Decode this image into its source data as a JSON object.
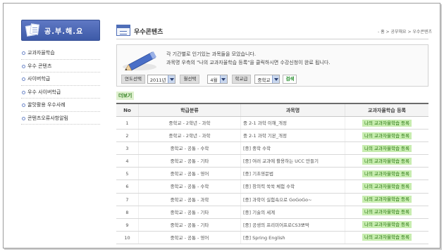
{
  "sidebar": {
    "title": "공.부.해.요",
    "items": [
      {
        "label": "교과자율학습"
      },
      {
        "label": "우수 콘텐츠"
      },
      {
        "label": "사이버학급"
      },
      {
        "label": "우수 사이버학급"
      },
      {
        "label": "꿀맛활용 우수사례"
      },
      {
        "label": "콘텐츠오류사항알림"
      }
    ]
  },
  "header": {
    "title": "우수콘텐츠",
    "breadcrumb": "- 홈 > 공부해요 > 우수콘텐츠"
  },
  "info": {
    "line1": "각 기간별로 인기있는 과목들을 모았습니다.",
    "line2": "과목명 우측의 \"나의 교과자율학습 등록\"을 클릭하시면 수강신청이 완료 됩니다."
  },
  "filters": {
    "year_label": "연도선택",
    "year_value": "2011년",
    "month_label": "월선택",
    "month_value": "4월",
    "school_label": "학교급",
    "school_value": "중학교",
    "search_label": "검색"
  },
  "more_label": "더보기",
  "table": {
    "headers": {
      "no": "No",
      "category": "학급분류",
      "title": "과목명",
      "register": "교과자율학습 등록"
    },
    "register_label": "나의 교과자율학습 등록",
    "rows": [
      {
        "no": "1",
        "category": "중학교 - 2학년 - 과학",
        "title": "중 2-1 과학 이해_개정"
      },
      {
        "no": "2",
        "category": "중학교 - 2학년 - 과학",
        "title": "중 2-1 과학 기본_개정"
      },
      {
        "no": "3",
        "category": "중학교 - 공통 - 수학",
        "title": "[중] 중학 수학"
      },
      {
        "no": "4",
        "category": "중학교 - 공통 - 기타",
        "title": "[중] 여러 교과에 활용하는 UCC 만들기"
      },
      {
        "no": "5",
        "category": "중학교 - 공통 - 영어",
        "title": "[중] 기초영문법"
      },
      {
        "no": "6",
        "category": "중학교 - 공통 - 수학",
        "title": "[중] 창의력 쑥쑥 체험 수학"
      },
      {
        "no": "7",
        "category": "중학교 - 공통 - 과학",
        "title": "[중] 과학이 실험속으로 GoGoGo~"
      },
      {
        "no": "8",
        "category": "중학교 - 공통 - 기타",
        "title": "[중] 기술의 세계"
      },
      {
        "no": "9",
        "category": "중학교 - 공통 - 기타",
        "title": "[중] 공생의 프리미어프로CS3뽀딱"
      },
      {
        "no": "10",
        "category": "중학교 - 공통 - 영어",
        "title": "[중] Spring English"
      }
    ]
  }
}
